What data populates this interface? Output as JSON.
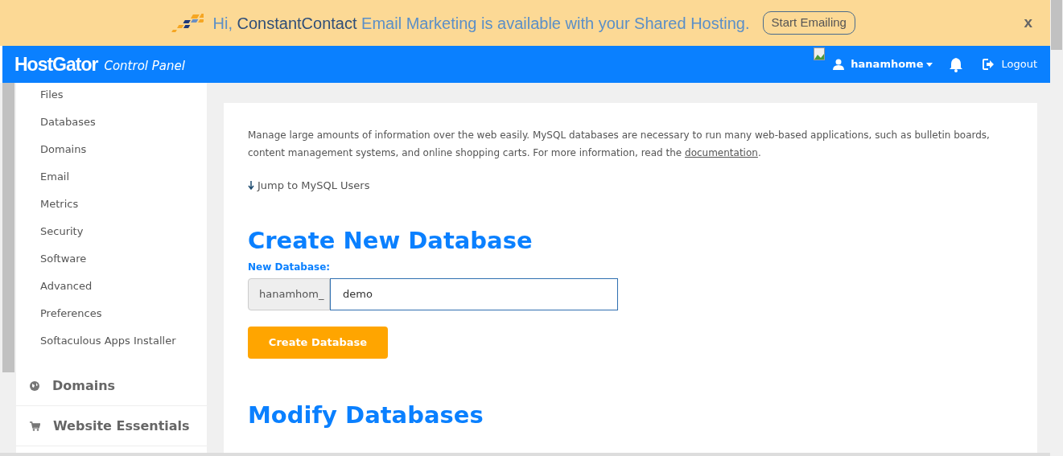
{
  "banner": {
    "greeting": "Hi,",
    "brand": "ConstantContact",
    "message": "Email Marketing is available with your Shared Hosting.",
    "button": "Start Emailing",
    "close": "x"
  },
  "header": {
    "logo": "HostGator",
    "subtitle": "Control Panel",
    "user": "hanamhome",
    "logout": "Logout"
  },
  "sidebar": {
    "items": [
      "Files",
      "Databases",
      "Domains",
      "Email",
      "Metrics",
      "Security",
      "Software",
      "Advanced",
      "Preferences",
      "Softaculous Apps Installer"
    ],
    "sections": [
      {
        "label": "Domains",
        "kind": "globe"
      },
      {
        "label": "Website Essentials",
        "kind": "cart"
      }
    ]
  },
  "content": {
    "intro_before": "Manage large amounts of information over the web easily. MySQL databases are necessary to run many web-based applications, such as bulletin boards, content management systems, and online shopping carts. For more information, read the",
    "intro_link": "documentation",
    "intro_after": ".",
    "jump_link": "Jump to MySQL Users",
    "create": {
      "heading": "Create New Database",
      "label": "New Database:",
      "prefix": "hanamhom_",
      "value": "demo",
      "button": "Create Database"
    },
    "modify": {
      "heading": "Modify Databases"
    }
  }
}
